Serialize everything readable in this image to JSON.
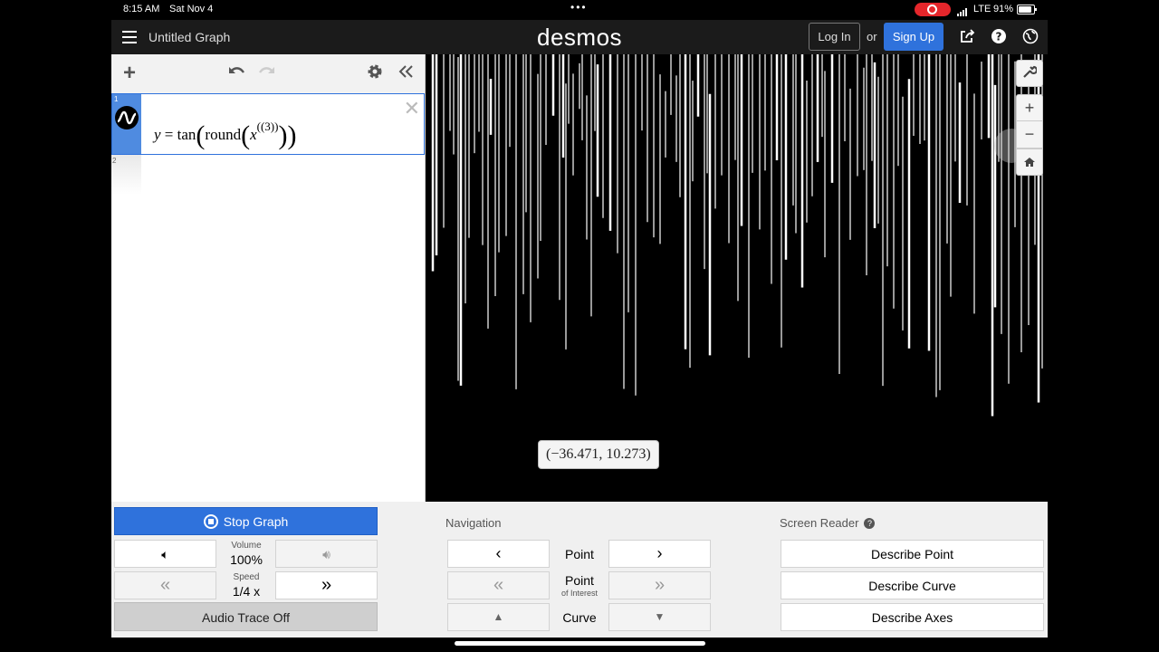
{
  "status": {
    "time": "8:15 AM",
    "date": "Sat Nov 4",
    "network": "LTE",
    "battery": "91%"
  },
  "topbar": {
    "title": "Untitled Graph",
    "logo": "desmos",
    "login": "Log In",
    "or": "or",
    "signup": "Sign Up",
    "icons": [
      "share-icon",
      "help-icon",
      "globe-icon"
    ]
  },
  "expressions": {
    "toolbar_icons": [
      "add-icon",
      "undo-icon",
      "redo-icon",
      "gear-icon",
      "collapse-icon"
    ],
    "rows": [
      {
        "index": "1",
        "latex": "y = tan(round(x((3))))"
      },
      {
        "index": "2",
        "latex": ""
      }
    ]
  },
  "graph": {
    "point_label": "(−36.471, 10.273)",
    "tools": [
      "wrench-icon",
      "zoom-in-icon",
      "zoom-out-icon",
      "home-icon"
    ],
    "line_color": "#ffffff",
    "background": "#000000"
  },
  "audio": {
    "stop_label": "Stop Graph",
    "volume_label": "Volume",
    "volume_value": "100%",
    "speed_label": "Speed",
    "speed_value": "1/4 x",
    "trace_label": "Audio Trace Off",
    "navigation_title": "Navigation",
    "nav_point": "Point",
    "nav_poi_main": "Point",
    "nav_poi_sub": "of Interest",
    "nav_curve": "Curve",
    "screen_reader_title": "Screen Reader",
    "describe_point": "Describe Point",
    "describe_curve": "Describe Curve",
    "describe_axes": "Describe Axes"
  },
  "colors": {
    "accent": "#2f72dc",
    "topbar": "#1b1b1b",
    "record": "#e5262b"
  }
}
